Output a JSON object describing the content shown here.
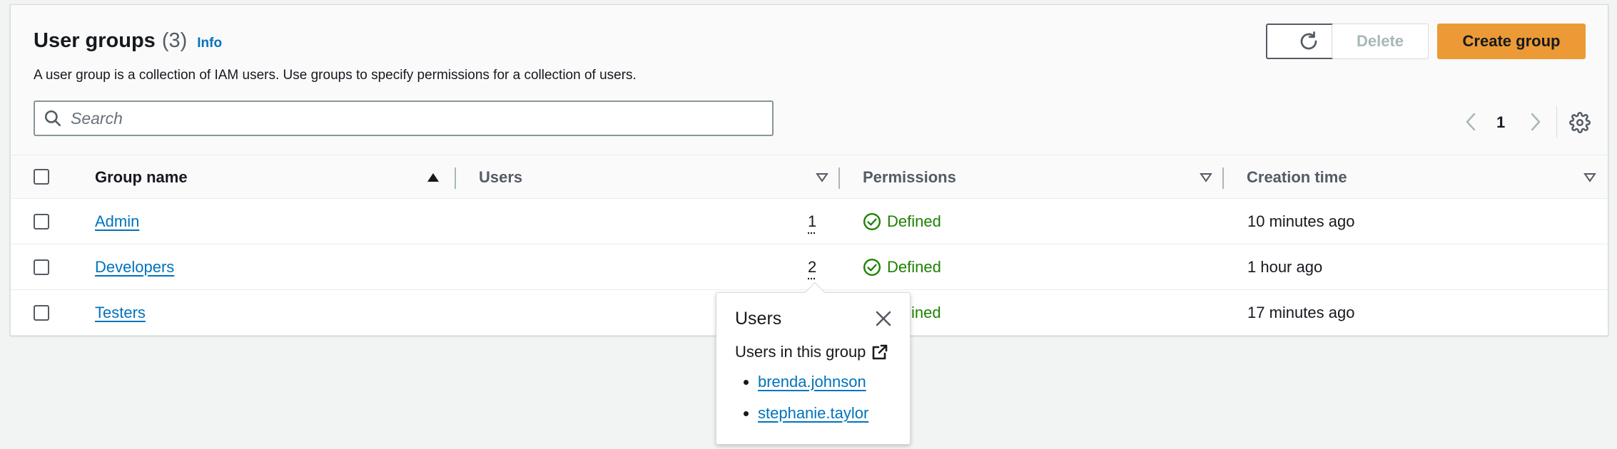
{
  "header": {
    "title": "User groups",
    "count": "(3)",
    "info_label": "Info",
    "description": "A user group is a collection of IAM users. Use groups to specify permissions for a collection of users."
  },
  "toolbar": {
    "refresh_icon": "refresh-icon",
    "delete_label": "Delete",
    "create_label": "Create group"
  },
  "search": {
    "placeholder": "Search",
    "value": ""
  },
  "pagination": {
    "current_page": "1"
  },
  "table": {
    "columns": [
      "Group name",
      "Users",
      "Permissions",
      "Creation time"
    ],
    "rows": [
      {
        "name": "Admin",
        "users": "1",
        "permissions": "Defined",
        "created": "10 minutes ago"
      },
      {
        "name": "Developers",
        "users": "2",
        "permissions": "Defined",
        "created": "1 hour ago"
      },
      {
        "name": "Testers",
        "users": "",
        "permissions": "ined",
        "created": "17 minutes ago"
      }
    ]
  },
  "popover": {
    "title": "Users",
    "subtitle": "Users in this group",
    "users": [
      "brenda.johnson",
      "stephanie.taylor"
    ]
  },
  "colors": {
    "accent": "#ec9a35",
    "link": "#0073bb",
    "success": "#1d8102"
  }
}
